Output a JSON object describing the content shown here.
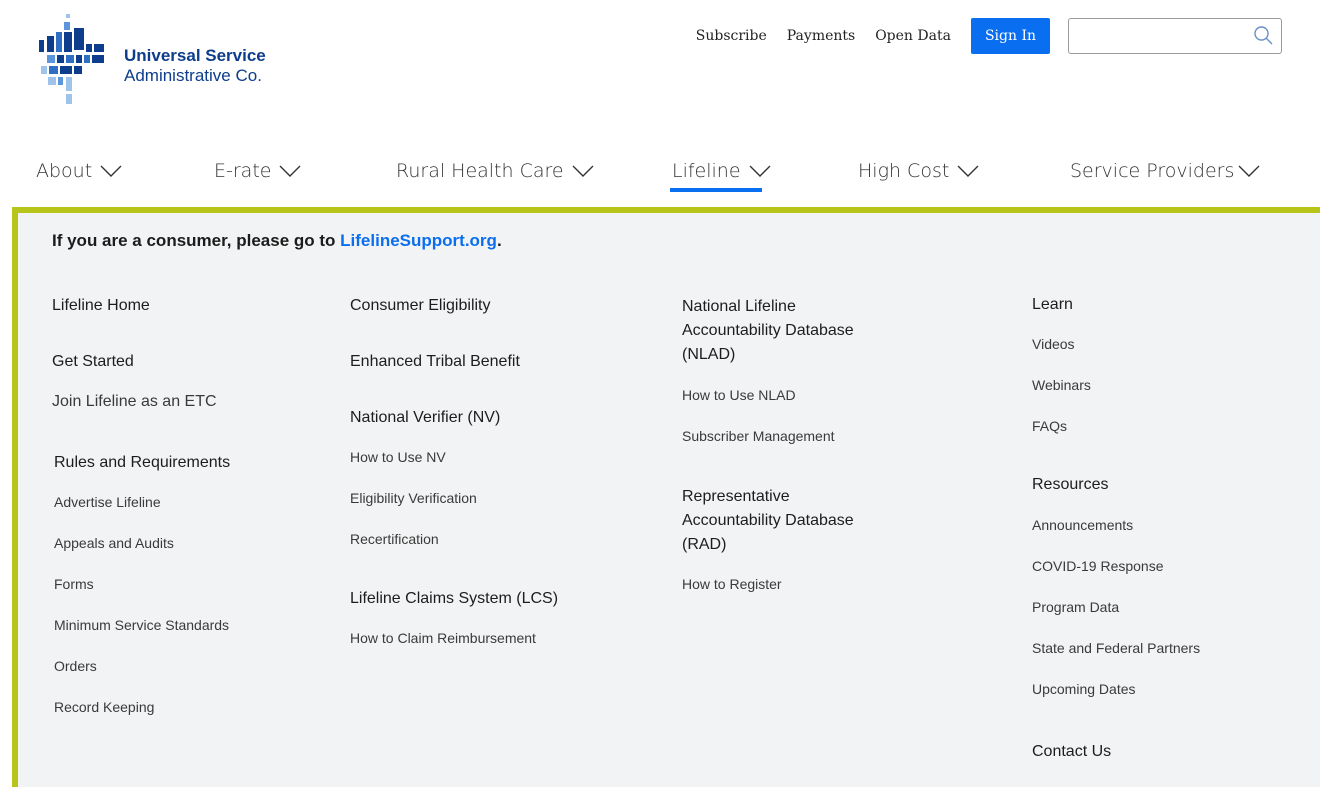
{
  "logo": {
    "line1": "Universal Service",
    "line2": "Administrative Co."
  },
  "utility": {
    "subscribe": "Subscribe",
    "payments": "Payments",
    "open_data": "Open Data",
    "sign_in": "Sign In",
    "search_value": ""
  },
  "nav": {
    "about": "About",
    "erate": "E-rate",
    "rhc": "Rural Health Care",
    "lifeline": "Lifeline",
    "high_cost": "High Cost",
    "service_providers": "Service Providers"
  },
  "dropdown": {
    "notice_prefix": "If you are a consumer, please go to ",
    "notice_link": "LifelineSupport.org",
    "notice_suffix": ".",
    "col1": {
      "lifeline_home": "Lifeline Home",
      "get_started": "Get Started",
      "join_etc": "Join Lifeline as an ETC",
      "rules": "Rules and Requirements",
      "rules_items": [
        "Advertise Lifeline",
        "Appeals and Audits",
        "Forms",
        "Minimum Service Standards",
        "Orders",
        "Record Keeping"
      ]
    },
    "col2": {
      "consumer_eligibility": "Consumer Eligibility",
      "enhanced_tribal": "Enhanced Tribal Benefit",
      "nv": "National Verifier (NV)",
      "nv_items": [
        "How to Use NV",
        "Eligibility Verification",
        "Recertification"
      ],
      "lcs": "Lifeline Claims System (LCS)",
      "lcs_items": [
        "How to Claim Reimbursement"
      ]
    },
    "col3": {
      "nlad_line1": "National Lifeline",
      "nlad_line2": "Accountability Database",
      "nlad_line3": "(NLAD)",
      "nlad_items": [
        "How to Use NLAD",
        "Subscriber Management"
      ],
      "rad_line1": "Representative",
      "rad_line2": "Accountability Database",
      "rad_line3": "(RAD)",
      "rad_items": [
        "How to Register"
      ]
    },
    "col4": {
      "learn": "Learn",
      "learn_items": [
        "Videos",
        "Webinars",
        "FAQs"
      ],
      "resources": "Resources",
      "resources_items": [
        "Announcements",
        "COVID-19 Response",
        "Program Data",
        "State and Federal Partners",
        "Upcoming Dates"
      ],
      "contact": "Contact Us"
    }
  },
  "colors": {
    "brand_navy": "#0d3d8c",
    "accent_blue": "#0a6ef0",
    "panel_border": "#b7c41a",
    "panel_bg": "#f2f3f4"
  }
}
